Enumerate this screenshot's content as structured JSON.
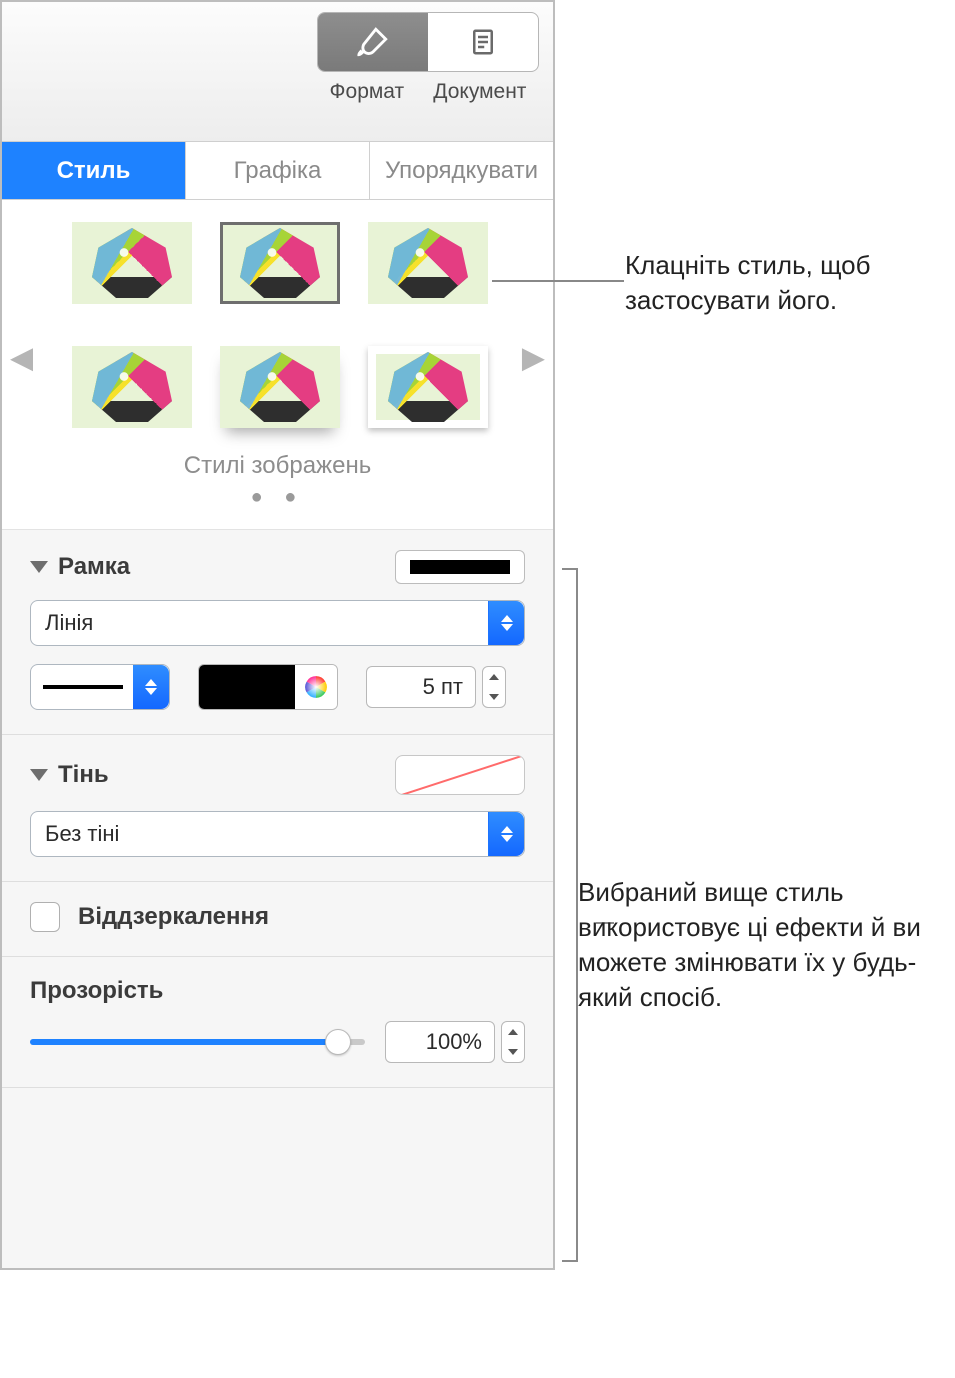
{
  "toolbar": {
    "format_label": "Формат",
    "document_label": "Документ"
  },
  "tabs": {
    "style": "Стиль",
    "graphic": "Графіка",
    "arrange": "Упорядкувати"
  },
  "gallery": {
    "title": "Стилі зображень"
  },
  "sections": {
    "frame": {
      "title": "Рамка",
      "type_combo": "Лінія",
      "stroke_value": "5 пт"
    },
    "shadow": {
      "title": "Тінь",
      "combo": "Без тіні"
    },
    "reflection": {
      "label": "Віддзеркалення"
    },
    "opacity": {
      "title": "Прозорість",
      "value": "100%"
    }
  },
  "callouts": {
    "apply_style": "Клацніть стиль, щоб застосувати його.",
    "effects": "Вибраний вище стиль використовує ці ефекти й ви можете змінювати їх у будь-який спосіб."
  }
}
